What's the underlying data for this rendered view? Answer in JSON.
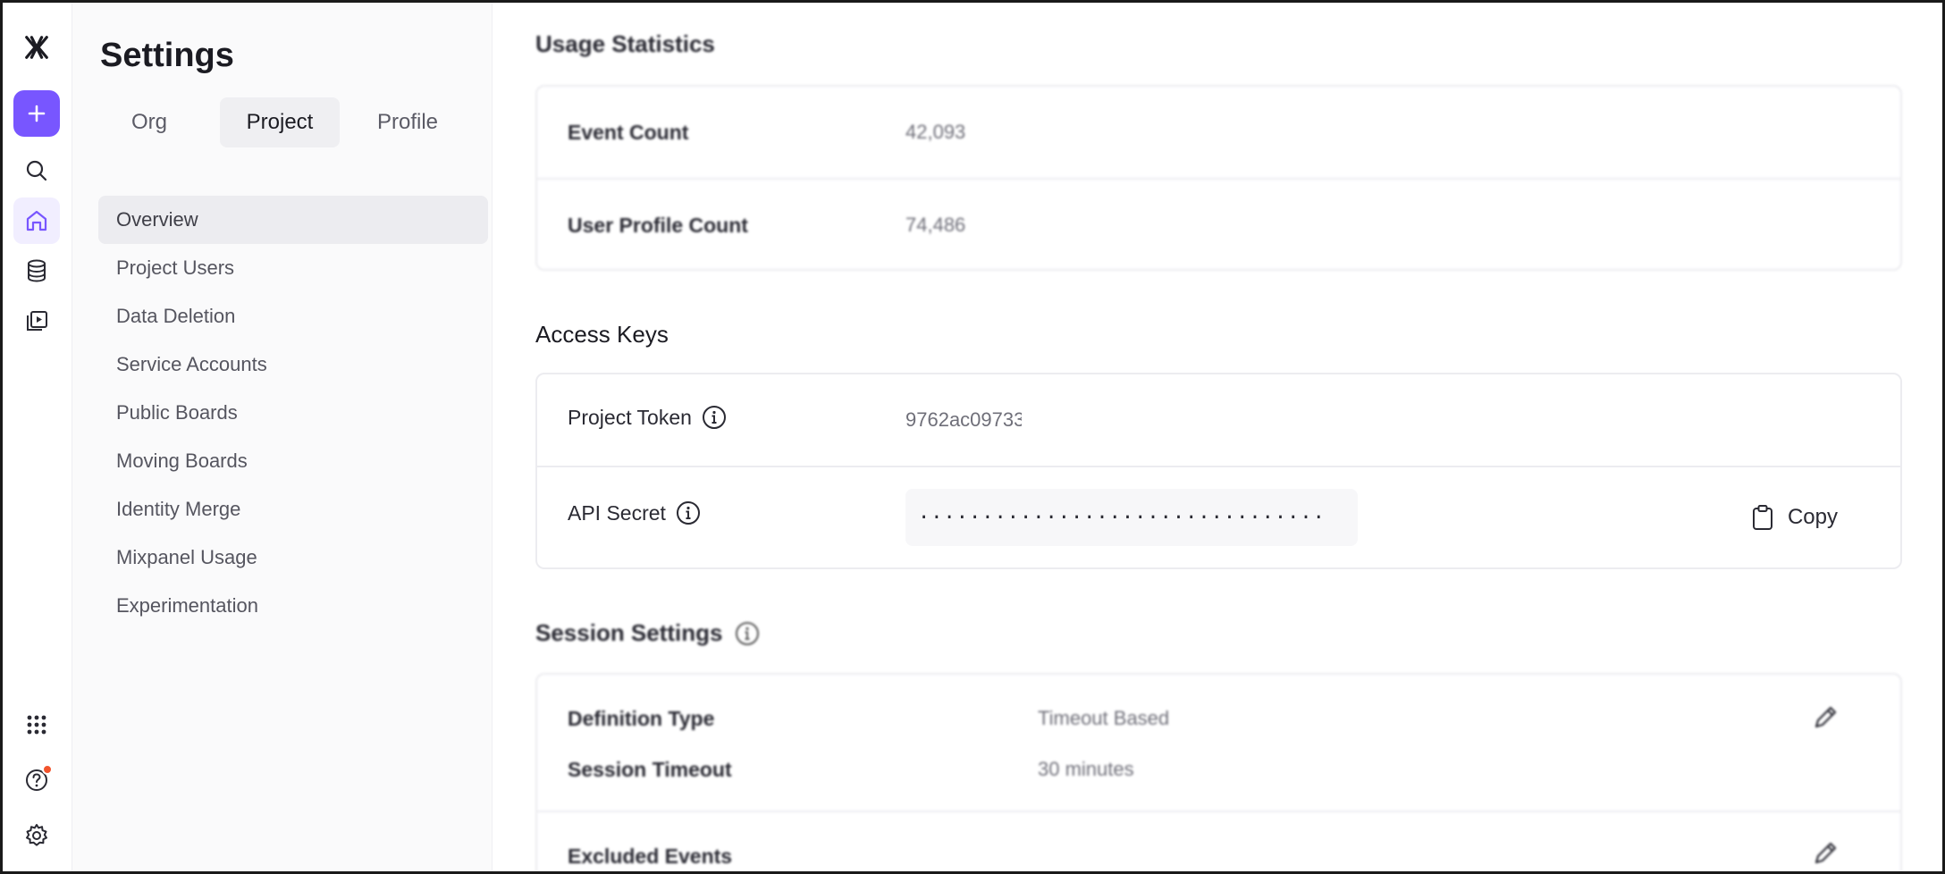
{
  "rail": {
    "items": [
      {
        "name": "mixpanel-logo-icon"
      },
      {
        "name": "create-icon"
      },
      {
        "name": "search-icon"
      },
      {
        "name": "home-icon"
      },
      {
        "name": "database-icon"
      },
      {
        "name": "boards-icon"
      },
      {
        "name": "apps-grid-icon"
      },
      {
        "name": "help-icon"
      },
      {
        "name": "settings-gear-icon"
      }
    ]
  },
  "settings": {
    "title": "Settings",
    "tabs": [
      {
        "label": "Org",
        "active": false
      },
      {
        "label": "Project",
        "active": true
      },
      {
        "label": "Profile",
        "active": false
      }
    ],
    "nav": [
      {
        "label": "Overview",
        "active": true
      },
      {
        "label": "Project Users"
      },
      {
        "label": "Data Deletion"
      },
      {
        "label": "Service Accounts"
      },
      {
        "label": "Public Boards"
      },
      {
        "label": "Moving Boards"
      },
      {
        "label": "Identity Merge"
      },
      {
        "label": "Mixpanel Usage"
      },
      {
        "label": "Experimentation"
      }
    ]
  },
  "usage": {
    "title": "Usage Statistics",
    "rows": [
      {
        "label": "Event Count",
        "value": "42,093"
      },
      {
        "label": "User Profile Count",
        "value": "74,486"
      }
    ]
  },
  "access_keys": {
    "title": "Access Keys",
    "project_token_label": "Project Token",
    "project_token_value": "9762ac09733",
    "api_secret_label": "API Secret",
    "api_secret_value": "································",
    "copy_label": "Copy"
  },
  "session": {
    "title": "Session Settings",
    "definition_type_label": "Definition Type",
    "definition_type_value": "Timeout Based",
    "session_timeout_label": "Session Timeout",
    "session_timeout_value": "30 minutes",
    "excluded_events_label": "Excluded Events"
  },
  "colors": {
    "accent": "#7856ff",
    "notification": "#f2542d"
  }
}
